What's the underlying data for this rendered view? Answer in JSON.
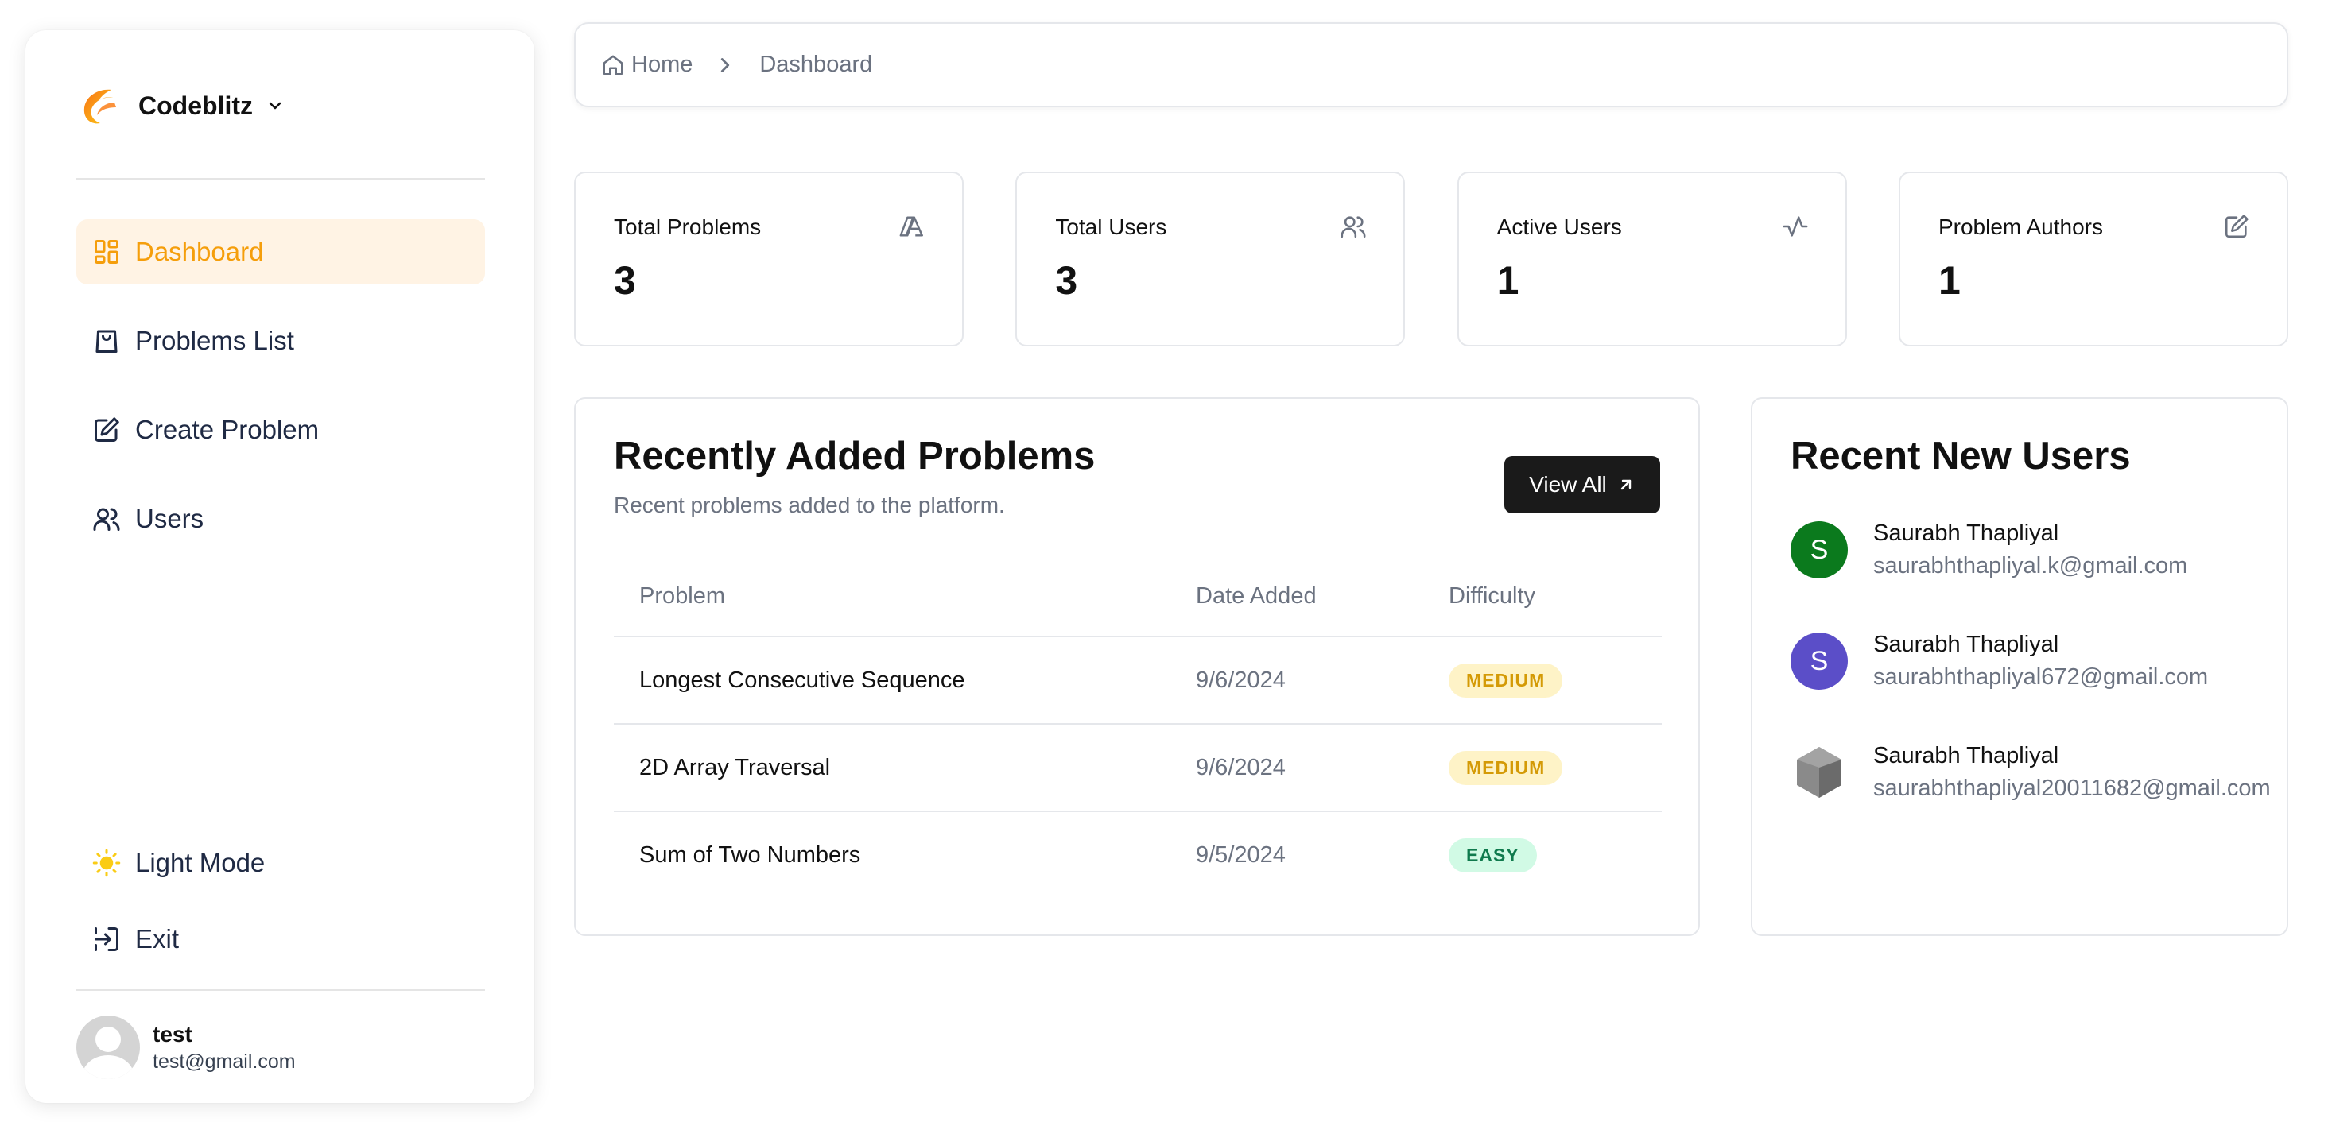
{
  "sidebar": {
    "brand": "Codeblitz",
    "nav": [
      {
        "label": "Dashboard",
        "icon": "dashboard-icon",
        "active": true
      },
      {
        "label": "Problems List",
        "icon": "shopping-bag-icon"
      },
      {
        "label": "Create Problem",
        "icon": "edit-icon"
      },
      {
        "label": "Users",
        "icon": "users-icon"
      }
    ],
    "theme_toggle": "Light Mode",
    "exit": "Exit",
    "user": {
      "name": "test",
      "email": "test@gmail.com"
    }
  },
  "breadcrumb": {
    "home": "Home",
    "current": "Dashboard"
  },
  "stats": [
    {
      "label": "Total Problems",
      "value": "3",
      "icon": "problems-icon"
    },
    {
      "label": "Total Users",
      "value": "3",
      "icon": "users-icon"
    },
    {
      "label": "Active Users",
      "value": "1",
      "icon": "activity-icon"
    },
    {
      "label": "Problem Authors",
      "value": "1",
      "icon": "edit-icon"
    }
  ],
  "recent_problems": {
    "title": "Recently Added Problems",
    "subtitle": "Recent problems added to the platform.",
    "view_all": "View All",
    "columns": [
      "Problem",
      "Date Added",
      "Difficulty"
    ],
    "rows": [
      {
        "problem": "Longest Consecutive Sequence",
        "date": "9/6/2024",
        "difficulty": "MEDIUM"
      },
      {
        "problem": "2D Array Traversal",
        "date": "9/6/2024",
        "difficulty": "MEDIUM"
      },
      {
        "problem": "Sum of Two Numbers",
        "date": "9/5/2024",
        "difficulty": "EASY"
      }
    ]
  },
  "recent_users": {
    "title": "Recent New Users",
    "users": [
      {
        "name": "Saurabh Thapliyal",
        "email": "saurabhthapliyal.k@gmail.com",
        "initial": "S",
        "color": "#0b7a1d"
      },
      {
        "name": "Saurabh Thapliyal",
        "email": "saurabhthapliyal672@gmail.com",
        "initial": "S",
        "color": "#5b4ec8"
      },
      {
        "name": "Saurabh Thapliyal",
        "email": "saurabhthapliyal20011682@gmail.com",
        "initial": "",
        "color": "#8a8a8a"
      }
    ]
  },
  "colors": {
    "accent": "#f59e0b",
    "active_bg": "#fff3e4",
    "medium_bg": "#fef3c7",
    "easy_bg": "#d1fae5"
  }
}
